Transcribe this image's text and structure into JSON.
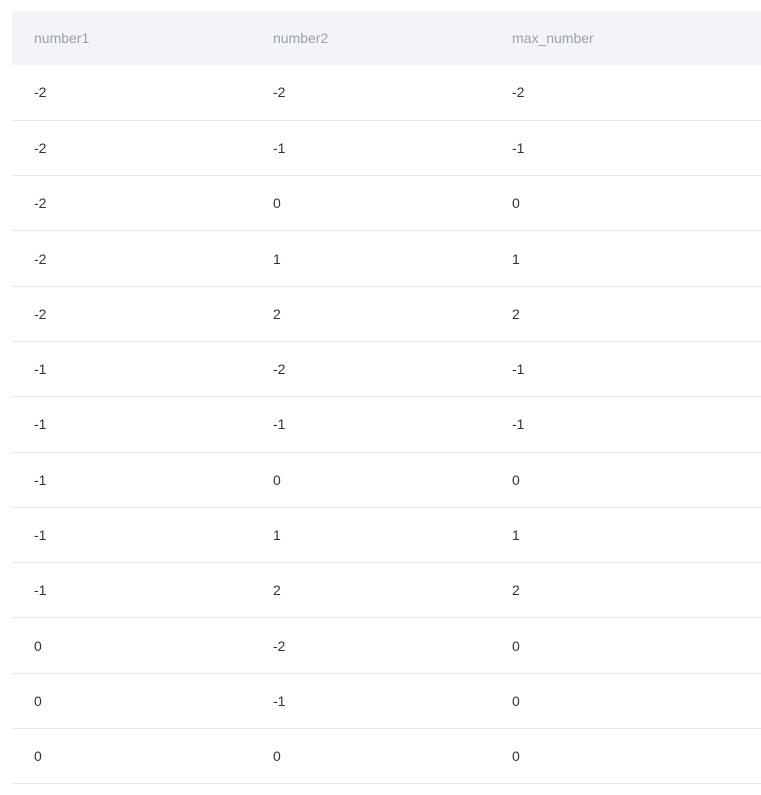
{
  "table": {
    "columns": [
      "number1",
      "number2",
      "max_number"
    ],
    "rows": [
      [
        "-2",
        "-2",
        "-2"
      ],
      [
        "-2",
        "-1",
        "-1"
      ],
      [
        "-2",
        "0",
        "0"
      ],
      [
        "-2",
        "1",
        "1"
      ],
      [
        "-2",
        "2",
        "2"
      ],
      [
        "-1",
        "-2",
        "-1"
      ],
      [
        "-1",
        "-1",
        "-1"
      ],
      [
        "-1",
        "0",
        "0"
      ],
      [
        "-1",
        "1",
        "1"
      ],
      [
        "-1",
        "2",
        "2"
      ],
      [
        "0",
        "-2",
        "0"
      ],
      [
        "0",
        "-1",
        "0"
      ],
      [
        "0",
        "0",
        "0"
      ]
    ]
  }
}
